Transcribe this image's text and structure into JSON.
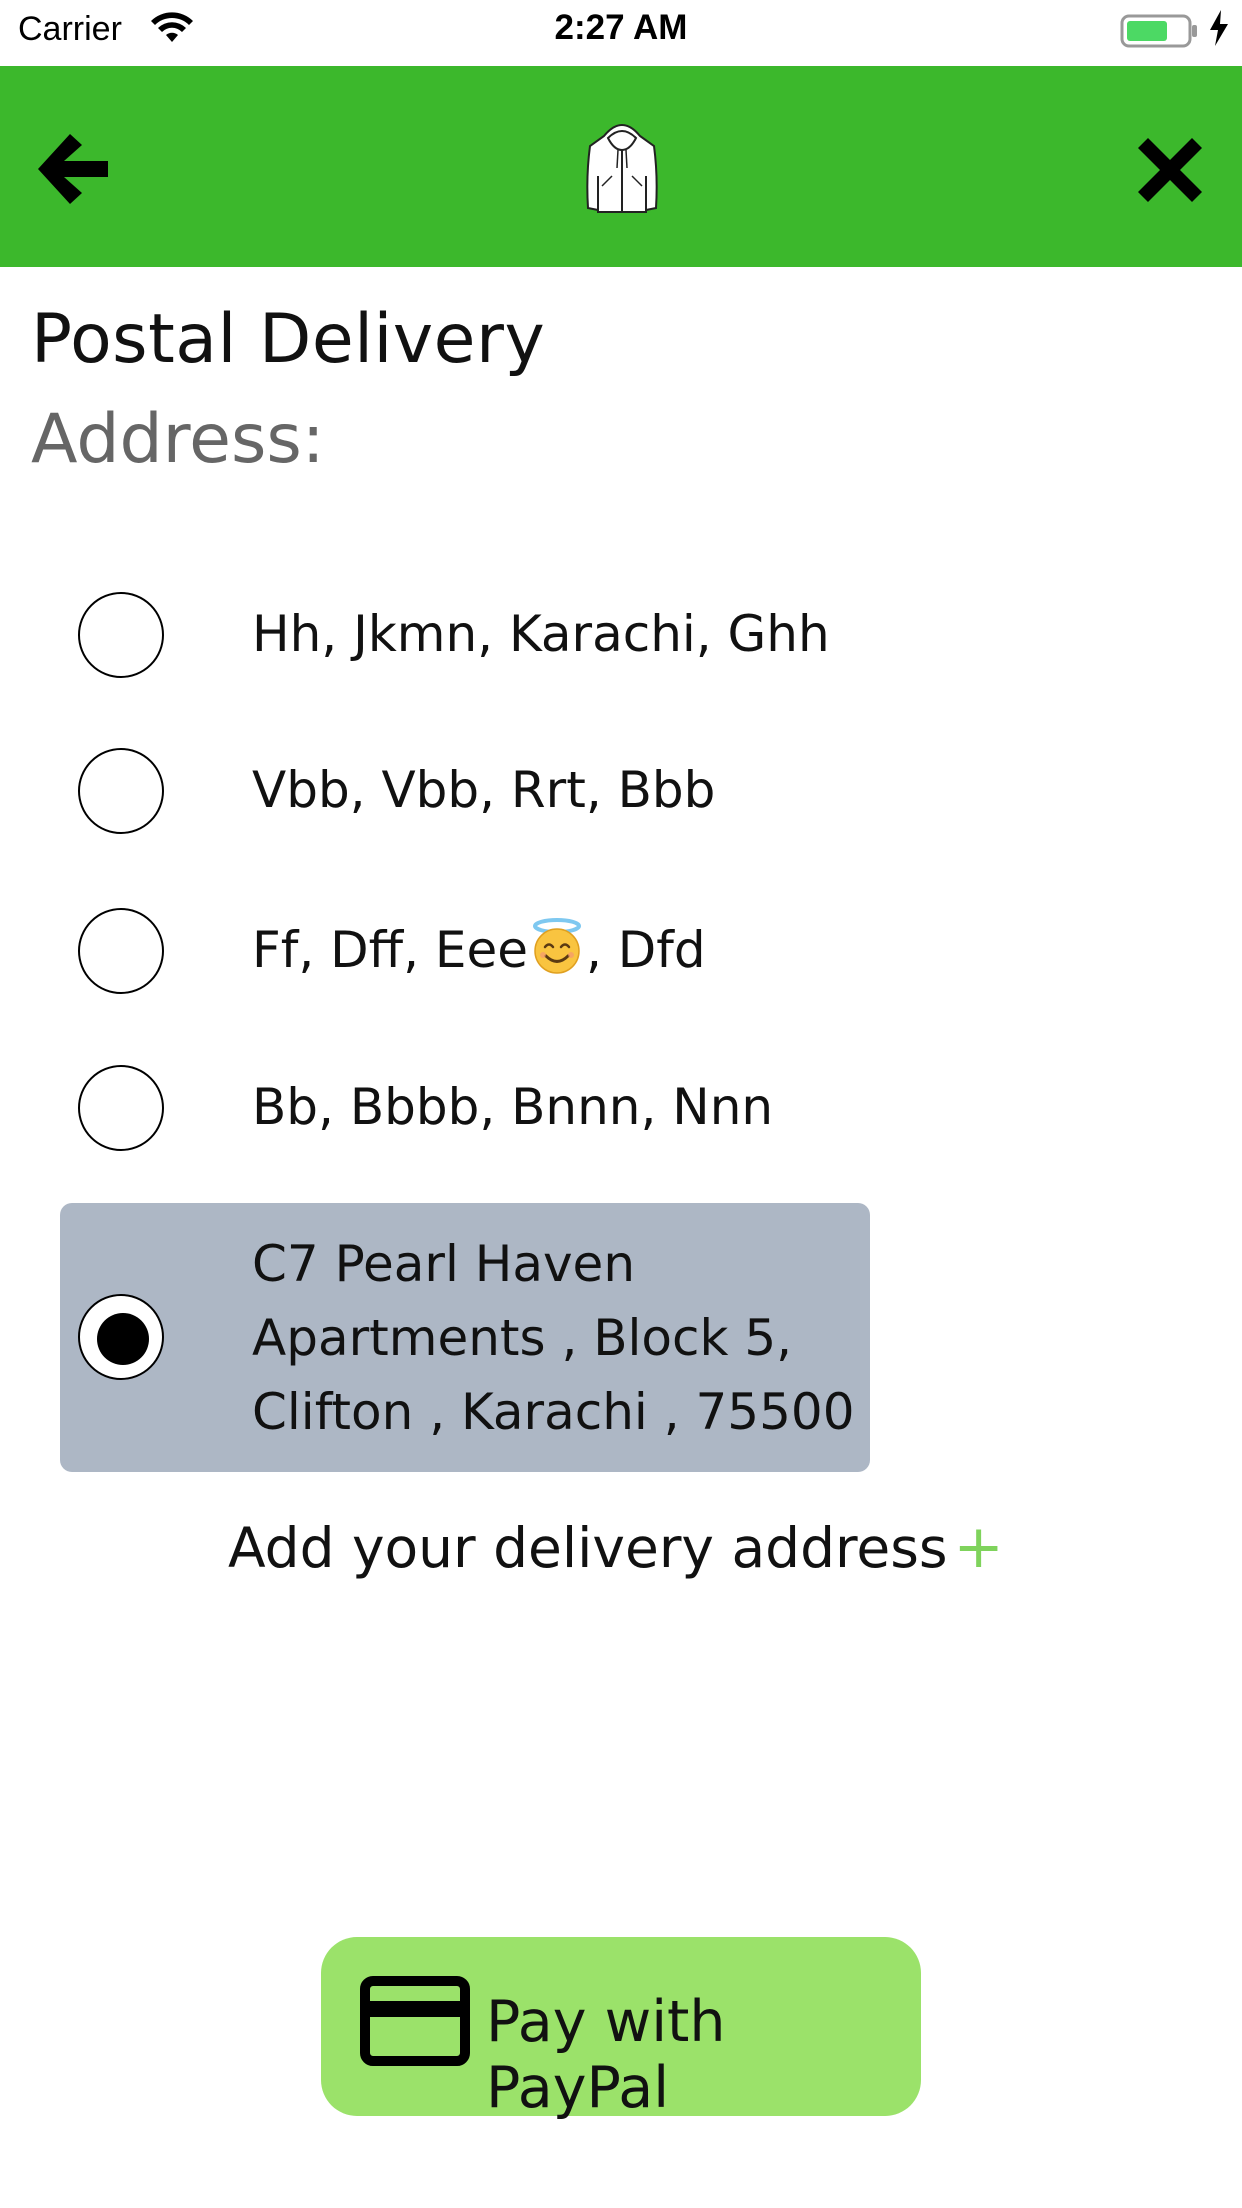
{
  "status_bar": {
    "carrier": "Carrier",
    "time": "2:27 AM"
  },
  "nav": {
    "back_icon": "back-arrow-icon",
    "logo_icon": "hoodie-icon",
    "close_icon": "close-x-icon",
    "background_color": "#3cb82c"
  },
  "page": {
    "title": "Postal Delivery",
    "address_label": "Address:"
  },
  "addresses": [
    {
      "text": "Hh, Jkmn, Karachi, Ghh",
      "selected": false
    },
    {
      "text": "Vbb, Vbb, Rrt, Bbb",
      "selected": false
    },
    {
      "text_before": "Ff, Dff, Eee",
      "emoji": "😇",
      "text_after": ", Dfd",
      "selected": false
    },
    {
      "text": "Bb, Bbbb, Bnnn, Nnn",
      "selected": false
    },
    {
      "text": "C7 Pearl Haven\nApartments , Block 5,\nClifton , Karachi , 75500",
      "selected": true
    }
  ],
  "add_address": {
    "label": "Add your delivery address",
    "plus": "+"
  },
  "pay_button": {
    "label": "Pay with PayPal",
    "icon": "credit-card-icon",
    "color": "#9be26a"
  }
}
